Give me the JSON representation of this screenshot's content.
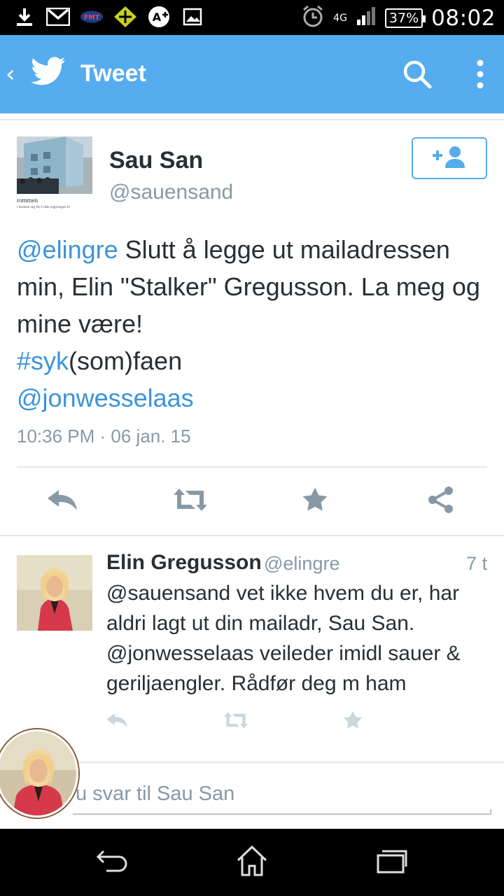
{
  "status_bar": {
    "time": "08:02",
    "battery": "37%",
    "network": "4G",
    "notification_icons": [
      "download-icon",
      "gmail-icon",
      "fmt-icon",
      "app-icon",
      "app-plus-icon",
      "image-icon"
    ]
  },
  "action_bar": {
    "title": "Tweet",
    "back_icon": "chevron-left-icon",
    "logo_icon": "twitter-bird-icon",
    "search_icon": "search-icon",
    "more_icon": "more-vertical-icon",
    "background_color": "#55acee"
  },
  "main_tweet": {
    "author_name": "Sau San",
    "author_handle": "@sauensand",
    "avatar_caption": "rommen",
    "avatar_subcaption": "r bestemt seg får å råde regjeringen til",
    "text_parts": {
      "mention1": "@elingre",
      "body1": " Slutt å legge ut mailadressen min, Elin \"Stalker\" Gregusson. La meg og mine være!",
      "hashtag": "#syk",
      "body2": "(som)faen",
      "mention2": "@jonwesselaas"
    },
    "timestamp": "10:36 PM · 06 jan. 15",
    "link_color": "#3b94d9",
    "actions": [
      "reply-icon",
      "retweet-icon",
      "favorite-icon",
      "share-icon"
    ]
  },
  "reply_tweet": {
    "author_name": "Elin Gregusson",
    "author_handle": "@elingre",
    "time": "7 t",
    "text": "@sauensand vet ikke hvem du er, har aldri lagt ut din mailadr, Sau San. @jonwesselaas veileder imidl sauer & geriljaengler. Rådfør deg m ham",
    "actions": [
      "reply-icon",
      "retweet-icon",
      "favorite-icon"
    ]
  },
  "compose": {
    "placeholder": "Svar til Sau San",
    "visible_text": "u svar til Sau San"
  },
  "nav_bar": {
    "buttons": [
      "back-icon",
      "home-icon",
      "recent-apps-icon"
    ]
  }
}
